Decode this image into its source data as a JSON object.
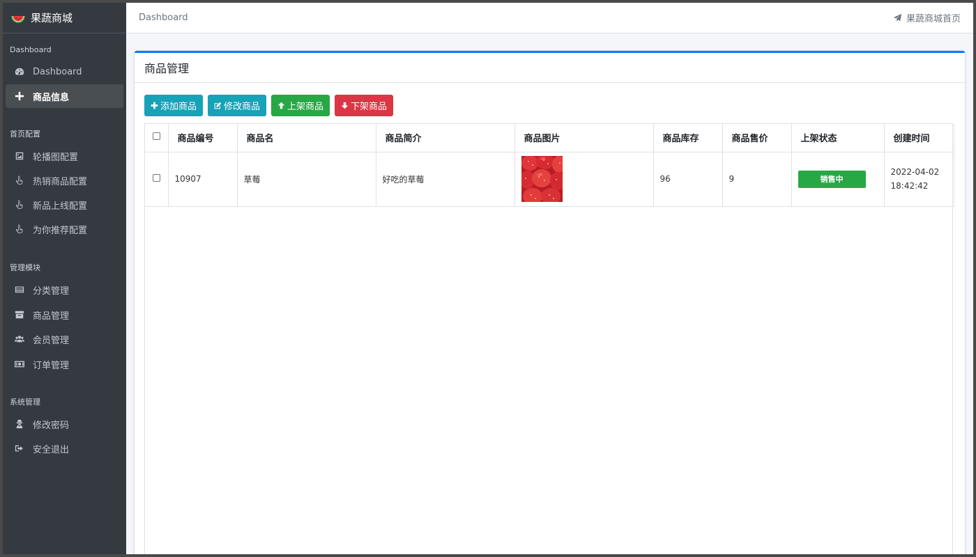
{
  "brand": {
    "name": "果蔬商城"
  },
  "sidebar": {
    "groups": [
      {
        "header": "Dashboard",
        "items": [
          {
            "label": "Dashboard",
            "icon": "dashboard-icon"
          },
          {
            "label": "商品信息",
            "icon": "plus-icon"
          }
        ]
      },
      {
        "header": "首页配置",
        "items": [
          {
            "label": "轮播图配置",
            "icon": "image-icon"
          },
          {
            "label": "热销商品配置",
            "icon": "hand-pointer-icon"
          },
          {
            "label": "新品上线配置",
            "icon": "hand-pointer-icon"
          },
          {
            "label": "为你推荐配置",
            "icon": "hand-pointer-icon"
          }
        ]
      },
      {
        "header": "管理模块",
        "items": [
          {
            "label": "分类管理",
            "icon": "list-icon"
          },
          {
            "label": "商品管理",
            "icon": "archive-icon"
          },
          {
            "label": "会员管理",
            "icon": "users-icon"
          },
          {
            "label": "订单管理",
            "icon": "money-icon"
          }
        ]
      },
      {
        "header": "系统管理",
        "items": [
          {
            "label": "修改密码",
            "icon": "user-secret-icon"
          },
          {
            "label": "安全退出",
            "icon": "sign-out-icon"
          }
        ]
      }
    ]
  },
  "topbar": {
    "breadcrumb": "Dashboard",
    "home_link": "果蔬商城首页"
  },
  "card": {
    "title": "商品管理"
  },
  "toolbar": {
    "add": "添加商品",
    "edit": "修改商品",
    "put_on": "上架商品",
    "take_off": "下架商品"
  },
  "table": {
    "headers": [
      "商品编号",
      "商品名",
      "商品简介",
      "商品图片",
      "商品库存",
      "商品售价",
      "上架状态",
      "创建时间"
    ],
    "rows": [
      {
        "id": "10907",
        "name": "草莓",
        "intro": "好吃的草莓",
        "stock": "96",
        "price": "9",
        "status": "销售中",
        "date": "2022-04-02",
        "time": "18:42:42"
      }
    ]
  },
  "colors": {
    "sidebar_bg": "#343a40",
    "primary": "#007bff",
    "info": "#17a2b8",
    "success": "#28a745",
    "danger": "#dc3545"
  }
}
